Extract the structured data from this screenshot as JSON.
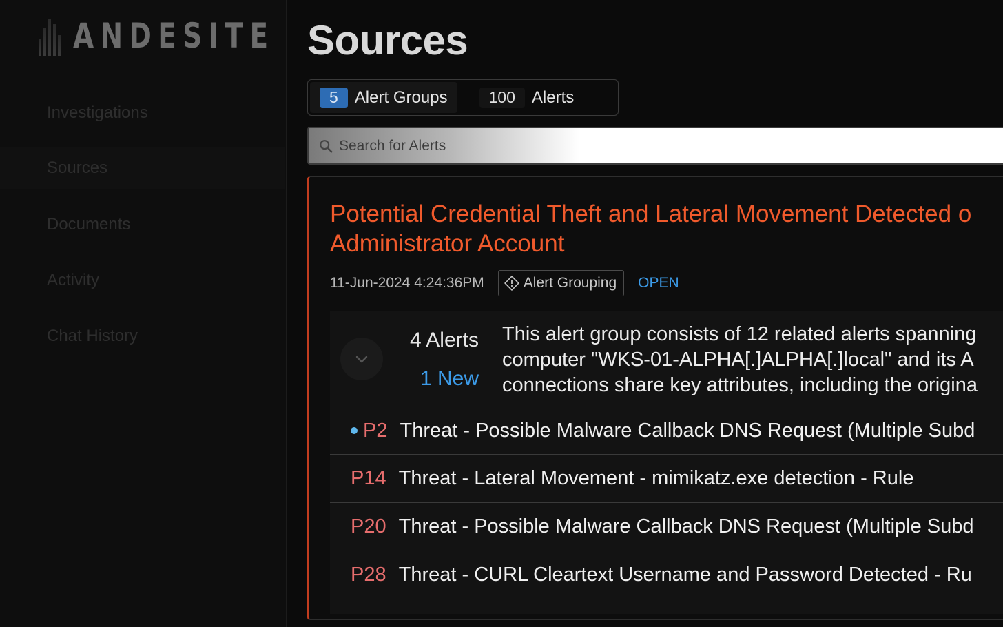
{
  "sidebar": {
    "logo_text": "ANDESITE",
    "items": [
      {
        "label": "Investigations"
      },
      {
        "label": "Sources"
      },
      {
        "label": "Documents"
      },
      {
        "label": "Activity"
      },
      {
        "label": "Chat History"
      }
    ]
  },
  "main": {
    "title": "Sources",
    "tabs": [
      {
        "count": "5",
        "label": "Alert Groups"
      },
      {
        "count": "100",
        "label": "Alerts"
      }
    ],
    "search": {
      "placeholder": "Search for Alerts"
    },
    "card": {
      "title_line1": "Potential Credential Theft and Lateral Movement Detected o",
      "title_line2": "Administrator Account",
      "timestamp": "11-Jun-2024 4:24:36PM",
      "chip_label": "Alert Grouping",
      "status": "OPEN",
      "group": {
        "alerts_count": "4 Alerts",
        "new_count": "1 New",
        "summary": "This alert group consists of 12 related alerts spanning\ncomputer \"WKS-01-ALPHA[.]ALPHA[.]local\" and its A\nconnections share key attributes, including the origina",
        "rows": [
          {
            "priority": "P2",
            "text": "Threat - Possible Malware Callback DNS Request (Multiple Subd"
          },
          {
            "priority": "P14",
            "text": "Threat - Lateral Movement - mimikatz.exe detection - Rule"
          },
          {
            "priority": "P20",
            "text": "Threat - Possible Malware Callback DNS Request (Multiple Subd"
          },
          {
            "priority": "P28",
            "text": "Threat - CURL Cleartext Username and Password Detected - Ru"
          }
        ]
      }
    }
  },
  "colors": {
    "accent_blue": "#2d6cb4",
    "title_orange": "#f05a2c",
    "priority_red": "#e66d6d",
    "status_blue": "#3c9be8",
    "card_border": "#c23d1f"
  },
  "icons": [
    "search-icon",
    "alert-diamond-icon",
    "chevron-down-icon",
    "new-dot-icon"
  ]
}
